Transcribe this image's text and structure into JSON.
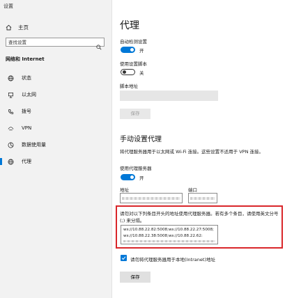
{
  "window": {
    "title": "设置"
  },
  "sidebar": {
    "home_label": "主页",
    "search_placeholder": "查找设置",
    "section_title": "网络和 Internet",
    "items": [
      {
        "label": "状态",
        "icon": "globe-icon"
      },
      {
        "label": "以太网",
        "icon": "ethernet-icon"
      },
      {
        "label": "拨号",
        "icon": "phone-icon"
      },
      {
        "label": "VPN",
        "icon": "vpn-icon"
      },
      {
        "label": "数据使用量",
        "icon": "data-usage-icon"
      },
      {
        "label": "代理",
        "icon": "globe-icon",
        "active": true
      }
    ]
  },
  "main": {
    "title": "代理",
    "auto_detect": {
      "label": "自动检测设置",
      "state": "开",
      "on": true
    },
    "use_script": {
      "label": "使用设置脚本",
      "state": "关",
      "on": false
    },
    "script_address": {
      "label": "脚本地址",
      "value": ""
    },
    "save_disabled_label": "保存",
    "manual_title": "手动设置代理",
    "manual_desc": "将代理服务器用于以太网或 Wi-Fi 连接。这些设置不适用于 VPN 连接。",
    "use_proxy": {
      "label": "使用代理服务器",
      "state": "开",
      "on": true
    },
    "address_label": "地址",
    "port_label": "端口",
    "exceptions_desc": "请勿对以下列条目开头的地址使用代理服务器。若有多个条目，请使用英文分号 (;) 来分隔。",
    "exceptions_value": "ws://10.88.22.82:5008;ws://10.88.22.27:5008;ws://10.88.22.38:5008;ws://10.88.22.62:",
    "bypass_local_label": "请勿将代理服务器用于本地(Intranet)地址",
    "save_label": "保存"
  },
  "colors": {
    "accent": "#0078d7",
    "highlight": "#d9262a"
  }
}
